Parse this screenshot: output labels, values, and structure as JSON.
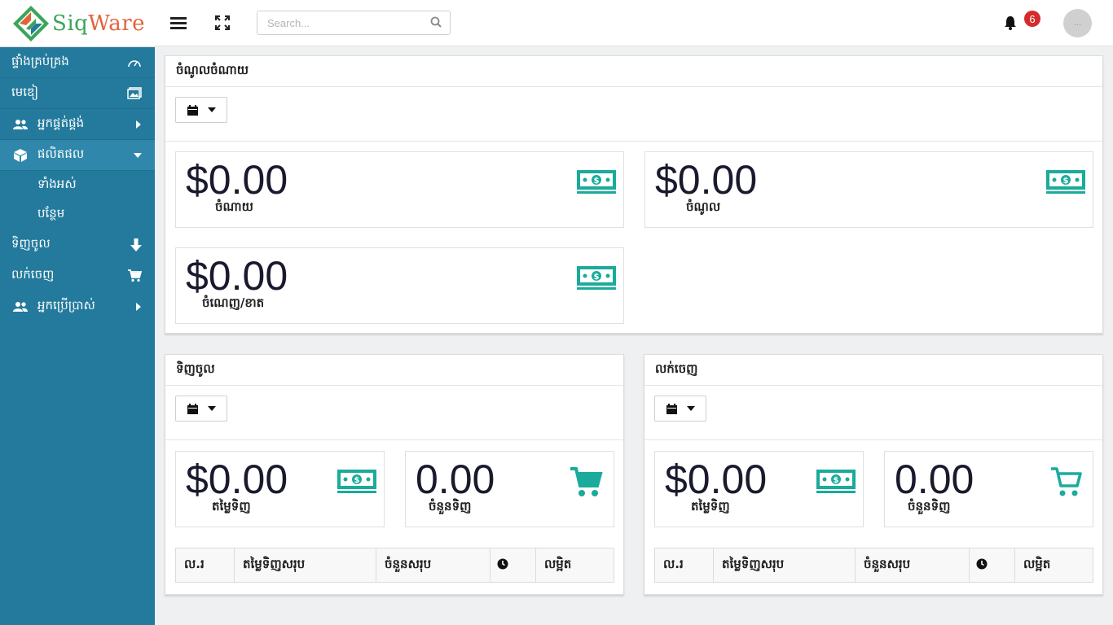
{
  "app": {
    "logo_s": "S",
    "logo_iq": "iq",
    "logo_w": "W",
    "logo_are": "are"
  },
  "search": {
    "placeholder": "Search..."
  },
  "notifications": {
    "count": "6"
  },
  "user": {
    "avatar_text": "..."
  },
  "sidebar": {
    "items": [
      {
        "label": "ផ្ទាំងគ្រប់គ្រង"
      },
      {
        "label": "មេឌៀ"
      },
      {
        "label": "អ្នកផ្គត់ផ្គង់"
      },
      {
        "label": "ផលិតផល"
      },
      {
        "label": "ទាំងអស់"
      },
      {
        "label": "បន្ថែម"
      },
      {
        "label": "ទិញចូល"
      },
      {
        "label": "លក់ចេញ"
      },
      {
        "label": "អ្នកប្រើប្រាស់"
      }
    ]
  },
  "finance": {
    "title": "ចំណូលចំណាយ",
    "expense": {
      "value": "$0.00",
      "label": "ចំណាយ"
    },
    "income": {
      "value": "$0.00",
      "label": "ចំណូល"
    },
    "profit": {
      "value": "$0.00",
      "label": "ចំណេញ/ខាត"
    }
  },
  "purchase": {
    "title": "ទិញចូល",
    "amount": {
      "value": "$0.00",
      "label": "តម្លៃទិញ"
    },
    "quantity": {
      "value": "0.00",
      "label": "ចំនួនទិញ"
    },
    "columns": [
      "ល.រ",
      "តម្លៃទិញសរុប",
      "ចំនួនសរុប",
      "",
      "លម្អិត"
    ]
  },
  "sale": {
    "title": "លក់ចេញ",
    "amount": {
      "value": "$0.00",
      "label": "តម្លៃទិញ"
    },
    "quantity": {
      "value": "0.00",
      "label": "ចំនួនទិញ"
    },
    "columns": [
      "ល.រ",
      "តម្លៃទិញសរុប",
      "ចំនួនសរុប",
      "",
      "លម្អិត"
    ]
  },
  "colors": {
    "sidebar": "#237a9c",
    "accent": "#1aab9b",
    "badge": "#d42c2c"
  }
}
